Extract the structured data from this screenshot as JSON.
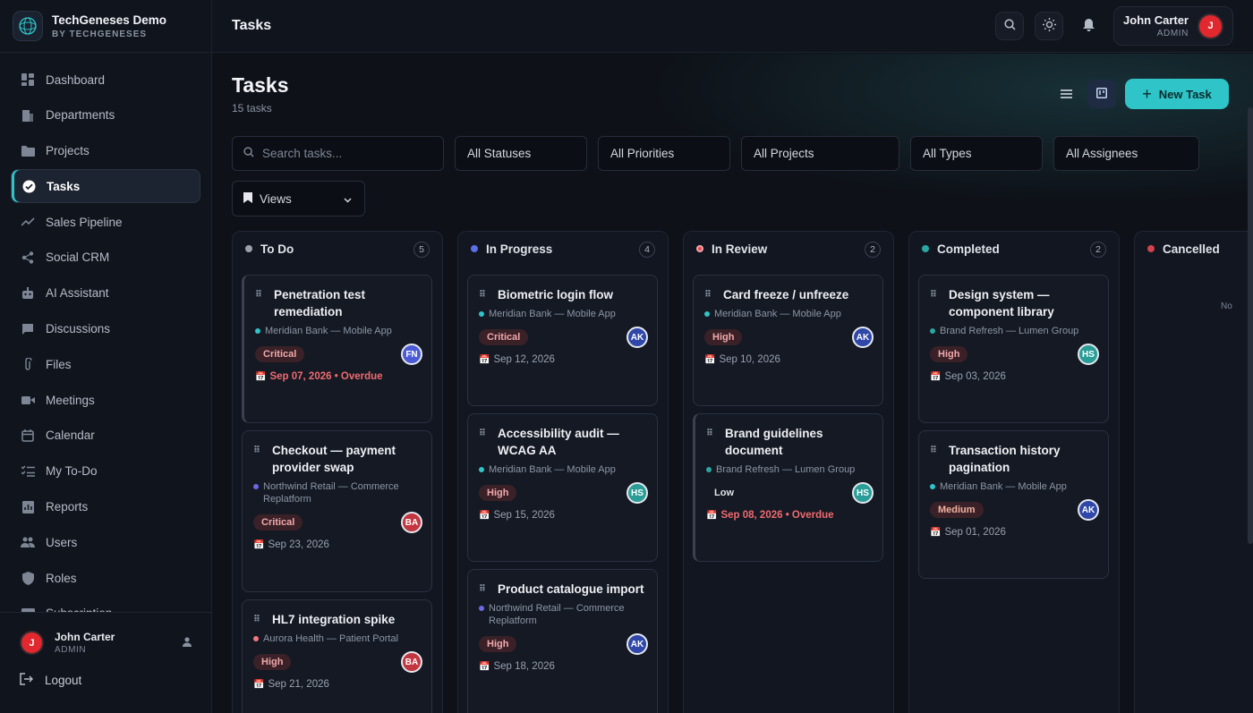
{
  "brand": {
    "name": "TechGeneses Demo",
    "sub": "BY TECHGENESES"
  },
  "sidebar": {
    "items": [
      {
        "label": "Dashboard",
        "icon": "dashboard-icon"
      },
      {
        "label": "Departments",
        "icon": "building-icon"
      },
      {
        "label": "Projects",
        "icon": "folder-icon"
      },
      {
        "label": "Tasks",
        "icon": "check-circle-icon",
        "active": true
      },
      {
        "label": "Sales Pipeline",
        "icon": "trending-icon"
      },
      {
        "label": "Social CRM",
        "icon": "share-icon"
      },
      {
        "label": "AI Assistant",
        "icon": "robot-icon"
      },
      {
        "label": "Discussions",
        "icon": "chat-icon"
      },
      {
        "label": "Files",
        "icon": "paperclip-icon"
      },
      {
        "label": "Meetings",
        "icon": "video-icon"
      },
      {
        "label": "Calendar",
        "icon": "calendar-icon"
      },
      {
        "label": "My To-Do",
        "icon": "checklist-icon"
      },
      {
        "label": "Reports",
        "icon": "report-icon"
      },
      {
        "label": "Users",
        "icon": "users-icon"
      },
      {
        "label": "Roles",
        "icon": "shield-icon"
      },
      {
        "label": "Subscription",
        "icon": "card-icon"
      }
    ],
    "user": {
      "name": "John Carter",
      "role": "ADMIN",
      "initial": "J"
    },
    "logout": "Logout"
  },
  "topbar": {
    "title": "Tasks",
    "user": {
      "name": "John Carter",
      "role": "ADMIN",
      "initial": "J"
    }
  },
  "page": {
    "title": "Tasks",
    "subtitle": "15 tasks",
    "new_task": "New Task"
  },
  "filters": {
    "search_placeholder": "Search tasks...",
    "statuses": "All Statuses",
    "priorities": "All Priorities",
    "projects": "All Projects",
    "types": "All Types",
    "assignees": "All Assignees",
    "views": "Views"
  },
  "colors": {
    "accent": "#2ec4c8",
    "todo": "#9aa1ae",
    "in_progress": "#5b6ee8",
    "in_review": "#e8474d",
    "completed": "#2aa7a3",
    "cancelled": "#d2424a"
  },
  "columns": [
    {
      "title": "To Do",
      "count": "5",
      "cards": [
        {
          "title": "Penetration test remediation",
          "project": "Meridian Bank — Mobile App",
          "priority": "Critical",
          "assignee": "FN",
          "date": "Sep 07, 2026 • Overdue"
        },
        {
          "title": "Checkout — payment provider swap",
          "project": "Northwind Retail — Commerce Replatform",
          "priority": "Critical",
          "assignee": "BA",
          "date": "Sep 23, 2026"
        },
        {
          "title": "HL7 integration spike",
          "project": "Aurora Health — Patient Portal",
          "priority": "High",
          "assignee": "BA",
          "date": "Sep 21, 2026"
        }
      ]
    },
    {
      "title": "In Progress",
      "count": "4",
      "cards": [
        {
          "title": "Biometric login flow",
          "project": "Meridian Bank — Mobile App",
          "priority": "Critical",
          "assignee": "AK",
          "date": "Sep 12, 2026"
        },
        {
          "title": "Accessibility audit — WCAG AA",
          "project": "Meridian Bank — Mobile App",
          "priority": "High",
          "assignee": "HS",
          "date": "Sep 15, 2026"
        },
        {
          "title": "Product catalogue import",
          "project": "Northwind Retail — Commerce Replatform",
          "priority": "High",
          "assignee": "AK",
          "date": "Sep 18, 2026"
        }
      ]
    },
    {
      "title": "In Review",
      "count": "2",
      "cards": [
        {
          "title": "Card freeze / unfreeze",
          "project": "Meridian Bank — Mobile App",
          "priority": "High",
          "assignee": "AK",
          "date": "Sep 10, 2026"
        },
        {
          "title": "Brand guidelines document",
          "project": "Brand Refresh — Lumen Group",
          "priority": "Low",
          "assignee": "HS",
          "date": "Sep 08, 2026 • Overdue"
        }
      ]
    },
    {
      "title": "Completed",
      "count": "2",
      "cards": [
        {
          "title": "Design system — component library",
          "project": "Brand Refresh — Lumen Group",
          "priority": "High",
          "assignee": "HS",
          "date": "Sep 03, 2026"
        },
        {
          "title": "Transaction history pagination",
          "project": "Meridian Bank — Mobile App",
          "priority": "Medium",
          "assignee": "AK",
          "date": "Sep 01, 2026"
        }
      ]
    },
    {
      "title": "Cancelled",
      "empty": "No"
    }
  ]
}
